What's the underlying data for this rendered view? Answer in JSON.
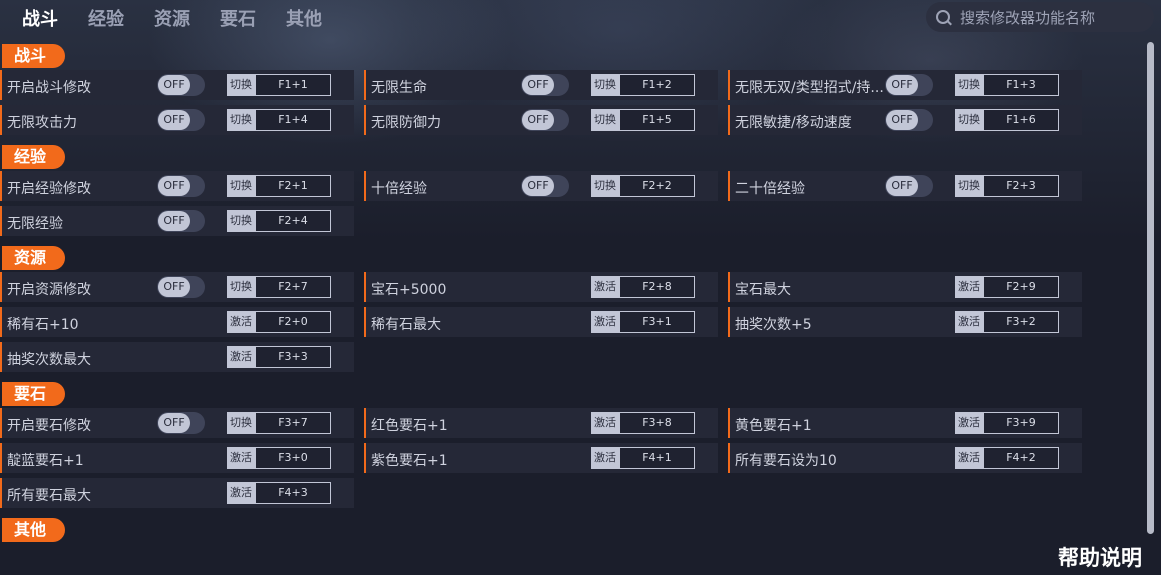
{
  "nav": {
    "tabs": [
      "战斗",
      "经验",
      "资源",
      "要石",
      "其他"
    ],
    "active_index": 0
  },
  "search": {
    "placeholder": "搜索修改器功能名称"
  },
  "help_label": "帮助说明",
  "toggle_off_label": "OFF",
  "colors": {
    "accent": "#f26a1b",
    "background": "#1b1e2b",
    "row": "#252837"
  },
  "sections": [
    {
      "title": "战斗",
      "items": [
        {
          "label": "开启战斗修改",
          "toggle": true,
          "action": "切换",
          "key": "F1+1"
        },
        {
          "label": "无限生命",
          "toggle": true,
          "action": "切换",
          "key": "F1+2"
        },
        {
          "label": "无限无双/类型招式/持...",
          "toggle": true,
          "action": "切换",
          "key": "F1+3"
        },
        {
          "label": "无限攻击力",
          "toggle": true,
          "action": "切换",
          "key": "F1+4"
        },
        {
          "label": "无限防御力",
          "toggle": true,
          "action": "切换",
          "key": "F1+5"
        },
        {
          "label": "无限敏捷/移动速度",
          "toggle": true,
          "action": "切换",
          "key": "F1+6"
        }
      ]
    },
    {
      "title": "经验",
      "items": [
        {
          "label": "开启经验修改",
          "toggle": true,
          "action": "切换",
          "key": "F2+1"
        },
        {
          "label": "十倍经验",
          "toggle": true,
          "action": "切换",
          "key": "F2+2"
        },
        {
          "label": "二十倍经验",
          "toggle": true,
          "action": "切换",
          "key": "F2+3"
        },
        {
          "label": "无限经验",
          "toggle": true,
          "action": "切换",
          "key": "F2+4"
        }
      ]
    },
    {
      "title": "资源",
      "items": [
        {
          "label": "开启资源修改",
          "toggle": true,
          "action": "切换",
          "key": "F2+7"
        },
        {
          "label": "宝石+5000",
          "toggle": false,
          "action": "激活",
          "key": "F2+8"
        },
        {
          "label": "宝石最大",
          "toggle": false,
          "action": "激活",
          "key": "F2+9"
        },
        {
          "label": "稀有石+10",
          "toggle": false,
          "action": "激活",
          "key": "F2+0"
        },
        {
          "label": "稀有石最大",
          "toggle": false,
          "action": "激活",
          "key": "F3+1"
        },
        {
          "label": "抽奖次数+5",
          "toggle": false,
          "action": "激活",
          "key": "F3+2"
        },
        {
          "label": "抽奖次数最大",
          "toggle": false,
          "action": "激活",
          "key": "F3+3"
        }
      ]
    },
    {
      "title": "要石",
      "items": [
        {
          "label": "开启要石修改",
          "toggle": true,
          "action": "切换",
          "key": "F3+7"
        },
        {
          "label": "红色要石+1",
          "toggle": false,
          "action": "激活",
          "key": "F3+8"
        },
        {
          "label": "黄色要石+1",
          "toggle": false,
          "action": "激活",
          "key": "F3+9"
        },
        {
          "label": "靛蓝要石+1",
          "toggle": false,
          "action": "激活",
          "key": "F3+0"
        },
        {
          "label": "紫色要石+1",
          "toggle": false,
          "action": "激活",
          "key": "F4+1"
        },
        {
          "label": "所有要石设为10",
          "toggle": false,
          "action": "激活",
          "key": "F4+2"
        },
        {
          "label": "所有要石最大",
          "toggle": false,
          "action": "激活",
          "key": "F4+3"
        }
      ]
    },
    {
      "title": "其他",
      "items": []
    }
  ]
}
